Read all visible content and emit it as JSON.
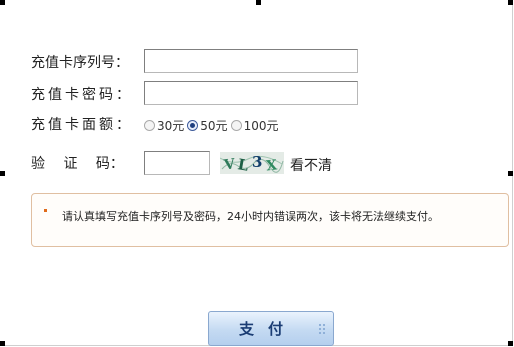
{
  "form": {
    "serial_label": "充值卡序列号：",
    "password_label": "充值卡密码：",
    "amount_label": "充值卡面额：",
    "captcha_label": "验 证 码：",
    "serial_value": "",
    "password_value": "",
    "captcha_value": ""
  },
  "amounts": {
    "options": [
      "30元",
      "50元",
      "100元"
    ],
    "selected": "50元"
  },
  "captcha": {
    "image_text": "VL3X",
    "refresh_label": "看不清"
  },
  "notice": {
    "text": "请认真填写充值卡序列号及密码，24小时内错误两次，该卡将无法继续支付。"
  },
  "actions": {
    "pay_label": "支付"
  },
  "colors": {
    "notice_border": "#e0bfa1",
    "notice_bullet": "#e06a1a",
    "button_text": "#1b3d74",
    "button_bg": "#c4daf2"
  }
}
